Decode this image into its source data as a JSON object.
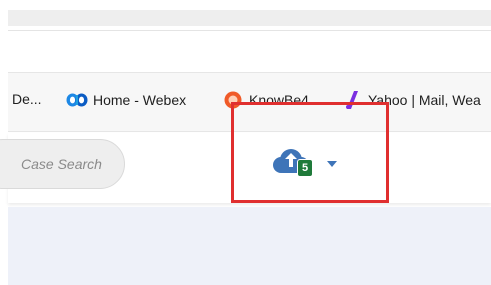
{
  "bookmarks": [
    {
      "label": "De...",
      "icon": ""
    },
    {
      "label": "Home - Webex",
      "icon": "webex-icon"
    },
    {
      "label": "KnowBe4",
      "icon": "knowbe4-icon"
    },
    {
      "label": "Yahoo | Mail, Wea",
      "icon": "yahoo-icon"
    }
  ],
  "search": {
    "placeholder": "Case Search"
  },
  "upload": {
    "icon": "cloud-upload-icon",
    "badge_count": "5",
    "dropdown_icon": "caret-down-icon"
  },
  "colors": {
    "highlight_border": "#e02f2f",
    "cloud_blue": "#3e74b8",
    "badge_green": "#1f7a3a",
    "content_background": "#eef1f9"
  }
}
